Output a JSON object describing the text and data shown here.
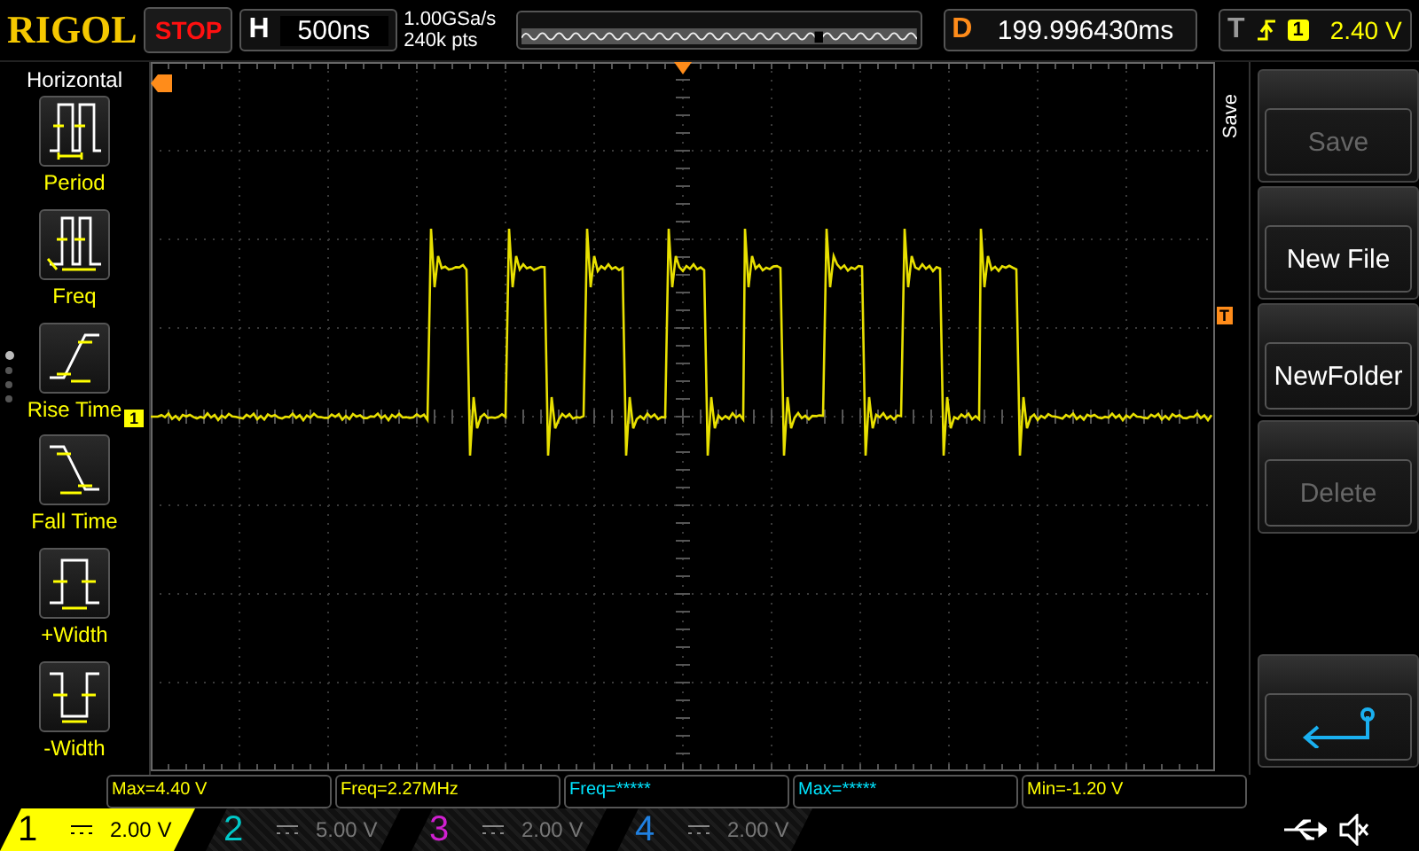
{
  "top_bar": {
    "logo": "RIGOL",
    "run_status": {
      "label": "STOP"
    },
    "timebase": {
      "key": "H",
      "value": "500ns"
    },
    "sample_rate": "1.00GSa/s",
    "memory_depth": "240k pts",
    "delay": {
      "key": "D",
      "value": "199.996430ms"
    },
    "trigger": {
      "key": "T",
      "source": "1",
      "level": "2.40 V"
    }
  },
  "sidebar": {
    "title": "Horizontal",
    "page_dots": [
      {
        "selected": true
      },
      {
        "selected": false
      },
      {
        "selected": false
      },
      {
        "selected": false
      }
    ],
    "items": [
      {
        "kind": "period",
        "label": "Period"
      },
      {
        "kind": "freq",
        "label": "Freq"
      },
      {
        "kind": "rise",
        "label": "Rise Time"
      },
      {
        "kind": "fall",
        "label": "Fall Time"
      },
      {
        "kind": "pwidth",
        "label": "+Width"
      },
      {
        "kind": "nwidth",
        "label": "-Width"
      }
    ]
  },
  "markers": {
    "channel_1": "1",
    "trigger_level": "T"
  },
  "menu": {
    "title": "Save",
    "buttons": [
      {
        "kind": "text",
        "label": "Save",
        "disabled": true
      },
      {
        "kind": "text",
        "label": "New File",
        "disabled": false
      },
      {
        "kind": "text",
        "label": "NewFolder",
        "disabled": false
      },
      {
        "kind": "text",
        "label": "Delete",
        "disabled": true
      },
      {
        "kind": "back",
        "disabled": false
      }
    ]
  },
  "measurements": [
    {
      "text": "Max=4.40 V",
      "color": "#ffff00"
    },
    {
      "text": "Freq=2.27MHz",
      "color": "#ffff00"
    },
    {
      "text": "Freq=*****",
      "color": "#00e5ff"
    },
    {
      "text": "Max=*****",
      "color": "#00e5ff"
    },
    {
      "text": "Min=-1.20 V",
      "color": "#ffff00"
    }
  ],
  "channels": [
    {
      "number": "1",
      "scale": "2.00 V",
      "active": true,
      "color": "#ffff00"
    },
    {
      "number": "2",
      "scale": "5.00 V",
      "active": false,
      "color": "#00c8c8"
    },
    {
      "number": "3",
      "scale": "2.00 V",
      "active": false,
      "color": "#d020d0"
    },
    {
      "number": "4",
      "scale": "2.00 V",
      "active": false,
      "color": "#2080e0"
    }
  ]
}
